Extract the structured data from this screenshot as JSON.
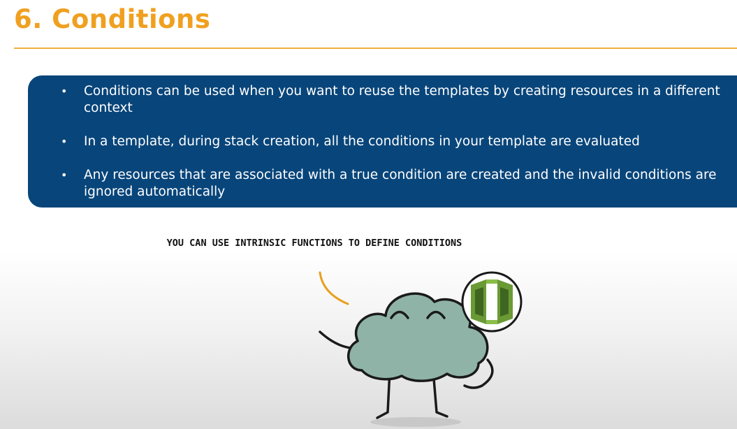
{
  "slide": {
    "title": "6. Conditions",
    "bullets": [
      "Conditions can be used when you want to reuse the templates by creating resources in a different context",
      "In a template, during stack creation, all the conditions in your template are evaluated",
      "Any resources that are associated with a true condition are created and the invalid conditions are ignored automatically"
    ],
    "speech_bubble_text": "YOU CAN USE INTRINSIC FUNCTIONS TO DEFINE CONDITIONS"
  },
  "colors": {
    "title": "#f0a020",
    "panel": "#08457a",
    "cloud": "#8fb3a7",
    "icon_green": "#6a9a35"
  },
  "icons": {
    "mascot": "cloud-character-icon",
    "service": "cloudformation-icon"
  }
}
